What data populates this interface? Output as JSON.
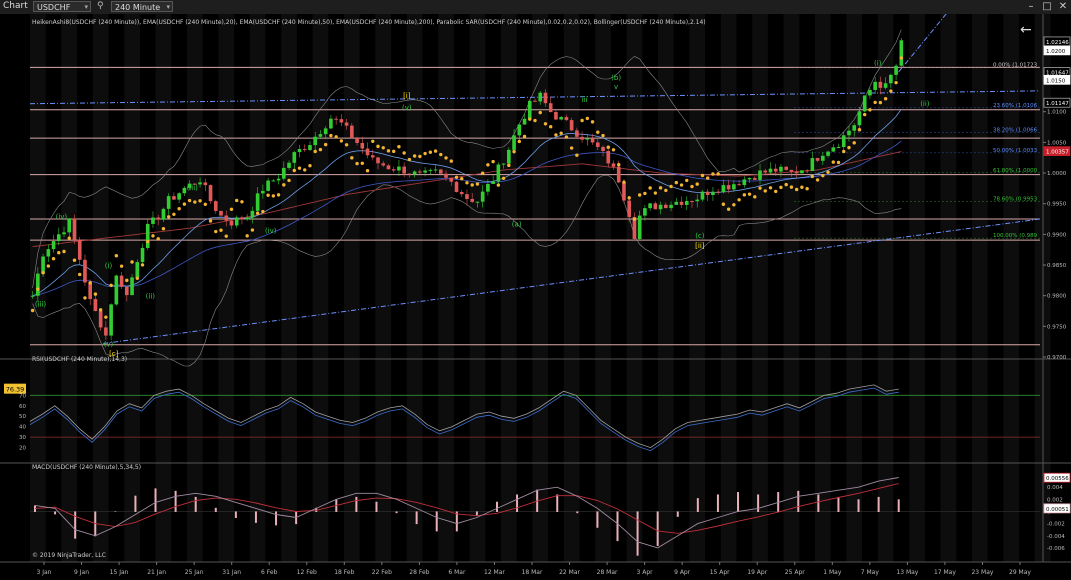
{
  "toolbar": {
    "menu_label": "Chart",
    "instrument": "USDCHF",
    "timeframe": "240 Minute",
    "search_icon": "search-icon",
    "window_icons": [
      "minimize-icon",
      "maximize-icon",
      "close-icon"
    ]
  },
  "indicators_title": "HeikenAshi8(USDCHF (240 Minute)), EMA(USDCHF (240 Minute),20), EMA(USDCHF (240 Minute),50), EMA(USDCHF (240 Minute),200), Parabolic SAR(USDCHF (240 Minute),0.02,0.2,0.02), Bollinger(USDCHF (240 Minute),2.14)",
  "rsi_title": "RSI(USDCHF (240 Minute),14,3)",
  "macd_title": "MACD(USDCHF (240 Minute),5,34,5)",
  "copyright": "© 2019 NinjaTrader, LLC",
  "back_arrow": "←",
  "colors": {
    "bull": "#32cd32",
    "bear": "#e05858",
    "sar": "#f2b431",
    "ema20": "#6b9ee8",
    "ema50": "#3f58c8",
    "ema200": "#a03838",
    "bollinger": "#8a8a8a",
    "hline": "#d9a9a9",
    "trend": "#6c8fff",
    "fib_pos": "#5d8eff",
    "fib_neg": "#34c234",
    "wave_green": "#2ecc40",
    "wave_yellow": "#ffe600"
  },
  "chart_data": [
    {
      "type": "candlestick",
      "symbol": "USDCHF",
      "timeframe": "240 Minute",
      "ylim": [
        0.97,
        1.023
      ],
      "y_ticks": [
        "1.0150",
        "1.0100",
        "1.0050",
        "1.0000",
        "0.9950",
        "0.9900",
        "0.9850",
        "0.9800",
        "0.9750",
        "0.9700"
      ],
      "y_tick_values": [
        1.015,
        1.01,
        1.005,
        1.0,
        0.995,
        0.99,
        0.985,
        0.98,
        0.975,
        0.97
      ],
      "x_ticks": [
        "3 Jan",
        "9 Jan",
        "15 Jan",
        "21 Jan",
        "25 Jan",
        "31 Jan",
        "6 Feb",
        "12 Feb",
        "18 Feb",
        "22 Feb",
        "28 Feb",
        "6 Mar",
        "12 Mar",
        "18 Mar",
        "22 Mar",
        "28 Mar",
        "3 Apr",
        "9 Apr",
        "15 Apr",
        "19 Apr",
        "25 Apr",
        "1 May",
        "7 May",
        "13 May",
        "17 May",
        "23 May",
        "29 May"
      ],
      "price_path": [
        [
          0,
          0.98
        ],
        [
          2,
          0.987
        ],
        [
          5,
          0.99
        ],
        [
          7,
          0.992
        ],
        [
          9,
          0.986
        ],
        [
          11,
          0.979
        ],
        [
          13,
          0.9755
        ],
        [
          14,
          0.9735
        ],
        [
          15,
          0.979
        ],
        [
          16,
          0.983
        ],
        [
          17,
          0.982
        ],
        [
          18,
          0.98
        ],
        [
          20,
          0.986
        ],
        [
          22,
          0.991
        ],
        [
          24,
          0.993
        ],
        [
          26,
          0.9955
        ],
        [
          29,
          0.9975
        ],
        [
          32,
          0.999
        ],
        [
          34,
          0.9955
        ],
        [
          36,
          0.993
        ],
        [
          38,
          0.992
        ],
        [
          41,
          0.993
        ],
        [
          44,
          0.9975
        ],
        [
          47,
          0.9995
        ],
        [
          50,
          1.003
        ],
        [
          53,
          1.005
        ],
        [
          55,
          1.007
        ],
        [
          57,
          1.009
        ],
        [
          59,
          1.008
        ],
        [
          61,
          1.006
        ],
        [
          63,
          1.004
        ],
        [
          65,
          1.002
        ],
        [
          68,
          1.001
        ],
        [
          71,
          1.0005
        ],
        [
          74,
          0.9995
        ],
        [
          77,
          1.0
        ],
        [
          80,
          0.9985
        ],
        [
          83,
          0.996
        ],
        [
          85,
          0.9955
        ],
        [
          88,
          0.999
        ],
        [
          91,
          1.004
        ],
        [
          93,
          1.008
        ],
        [
          95,
          1.011
        ],
        [
          97,
          1.0125
        ],
        [
          99,
          1.01
        ],
        [
          102,
          1.008
        ],
        [
          105,
          1.006
        ],
        [
          108,
          1.004
        ],
        [
          110,
          1.002
        ],
        [
          112,
          0.999
        ],
        [
          114,
          0.9935
        ],
        [
          115,
          0.99
        ],
        [
          116,
          0.993
        ],
        [
          118,
          0.9945
        ],
        [
          121,
          0.995
        ],
        [
          124,
          0.9955
        ],
        [
          127,
          0.996
        ],
        [
          130,
          0.9975
        ],
        [
          133,
          0.998
        ],
        [
          136,
          0.999
        ],
        [
          139,
          1.0
        ],
        [
          142,
          1.0005
        ],
        [
          145,
          1.0
        ],
        [
          148,
          1.001
        ],
        [
          151,
          1.0035
        ],
        [
          154,
          1.005
        ],
        [
          157,
          1.008
        ],
        [
          159,
          1.012
        ],
        [
          161,
          1.015
        ],
        [
          163,
          1.014
        ],
        [
          165,
          1.0175
        ],
        [
          166,
          1.021
        ]
      ],
      "ema200_path": [
        [
          0,
          0.988
        ],
        [
          15,
          0.9895
        ],
        [
          30,
          0.991
        ],
        [
          45,
          0.9935
        ],
        [
          60,
          0.9965
        ],
        [
          75,
          0.9985
        ],
        [
          90,
          1.0005
        ],
        [
          105,
          1.0015
        ],
        [
          120,
          1.0
        ],
        [
          135,
          0.9995
        ],
        [
          150,
          1.0005
        ],
        [
          166,
          1.0035
        ]
      ],
      "horizontal_levels": [
        1.01723,
        1.01033,
        1.0057,
        0.99975,
        0.9925,
        0.98905,
        0.972
      ],
      "trendlines": [
        {
          "name": "upper-channel",
          "from": [
            0,
            1.0113
          ],
          "to": [
            193,
            1.0134
          ]
        },
        {
          "name": "lower-channel",
          "from": [
            14,
            0.9722
          ],
          "to": [
            193,
            0.9925
          ]
        },
        {
          "name": "projection",
          "from": [
            166,
            1.0165
          ],
          "to": [
            178,
            1.029
          ]
        }
      ],
      "fib_levels": [
        {
          "label": "0.00% (1.01723",
          "value": 1.01723
        },
        {
          "label": "23.60% (1.0106",
          "value": 1.01064
        },
        {
          "label": "38.20% (1.0066",
          "value": 1.00658
        },
        {
          "label": "50.00% (1.0033",
          "value": 1.0033
        },
        {
          "label": "61.80% (1.0000",
          "value": 1.00003
        },
        {
          "label": "78.60% (0.9953",
          "value": 0.99535
        },
        {
          "label": "100.00% (0.989",
          "value": 0.98938
        }
      ],
      "price_flags": [
        {
          "text": "1.02146",
          "value": 1.02146,
          "style": "outline"
        },
        {
          "text": "1.0200",
          "value": 1.02,
          "style": "white"
        },
        {
          "text": "1.01647",
          "value": 1.01647,
          "style": "outline"
        },
        {
          "text": "1.0150",
          "value": 1.0152,
          "style": "white"
        },
        {
          "text": "1.01147",
          "value": 1.01147,
          "style": "outline"
        },
        {
          "text": "1.00357",
          "value": 1.00357,
          "style": "red"
        }
      ],
      "wave_labels": [
        {
          "text": "(iv)",
          "x": 6,
          "value": 0.9925,
          "color": "green"
        },
        {
          "text": "(iii)",
          "x": 2,
          "value": 0.9782,
          "color": "green"
        },
        {
          "text": "(i)",
          "x": 15,
          "value": 0.9845,
          "color": "green"
        },
        {
          "text": "(ii)",
          "x": 23,
          "value": 0.9795,
          "color": "green"
        },
        {
          "text": "(v)",
          "x": 15,
          "value": 0.9717,
          "color": "green"
        },
        {
          "text": "[c]",
          "x": 16,
          "value": 0.9702,
          "color": "yellow"
        },
        {
          "text": "(iii)",
          "x": 31,
          "value": 0.9972,
          "color": "green"
        },
        {
          "text": "(iv)",
          "x": 46,
          "value": 0.9902,
          "color": "green"
        },
        {
          "text": "[i]",
          "x": 72,
          "value": 1.0122,
          "color": "yellow"
        },
        {
          "text": "(v)",
          "x": 72,
          "value": 1.0103,
          "color": "green"
        },
        {
          "text": "(a)",
          "x": 93,
          "value": 0.9913,
          "color": "green"
        },
        {
          "text": "iii",
          "x": 106,
          "value": 1.0116,
          "color": "green"
        },
        {
          "text": "(b)",
          "x": 112,
          "value": 1.0152,
          "color": "green"
        },
        {
          "text": "v",
          "x": 112,
          "value": 1.0137,
          "color": "green"
        },
        {
          "text": "(c)",
          "x": 128,
          "value": 0.9894,
          "color": "green"
        },
        {
          "text": "[ii]",
          "x": 128,
          "value": 0.9878,
          "color": "yellow"
        },
        {
          "text": "(i)",
          "x": 162,
          "value": 1.0175,
          "color": "green"
        },
        {
          "text": "(ii)",
          "x": 171,
          "value": 1.0109,
          "color": "green"
        }
      ]
    },
    {
      "type": "line",
      "name": "rsi",
      "ylim": [
        10,
        100
      ],
      "y_ticks": [
        70,
        60,
        50,
        40,
        30,
        20
      ],
      "levels": [
        70,
        30
      ],
      "current_value": "76.39",
      "values": [
        45,
        52,
        60,
        50,
        38,
        28,
        40,
        55,
        62,
        58,
        70,
        74,
        76,
        70,
        62,
        55,
        48,
        44,
        50,
        56,
        60,
        68,
        62,
        54,
        50,
        46,
        44,
        48,
        54,
        58,
        60,
        52,
        42,
        36,
        40,
        46,
        52,
        54,
        50,
        48,
        52,
        58,
        66,
        74,
        70,
        58,
        46,
        38,
        30,
        24,
        20,
        28,
        38,
        44,
        46,
        48,
        50,
        52,
        56,
        54,
        58,
        62,
        58,
        64,
        70,
        72,
        76,
        78,
        80,
        74,
        76
      ]
    },
    {
      "type": "bar_line",
      "name": "macd",
      "ylim": [
        -0.0075,
        0.0065
      ],
      "y_ticks": [
        "0.004",
        "0.002",
        "0",
        "-0.002",
        "-0.004",
        "-0.006"
      ],
      "y_tick_values": [
        0.004,
        0.002,
        0.0,
        -0.002,
        -0.004,
        -0.006
      ],
      "current_value": "0.00556",
      "signal_value": "0.00051",
      "macd_values": [
        0.001,
        0.0005,
        -0.003,
        -0.004,
        -0.0025,
        -0.0005,
        0.0015,
        0.0025,
        0.003,
        0.0025,
        0.0015,
        0.0005,
        -0.0005,
        -0.001,
        0.0005,
        0.002,
        0.003,
        0.003,
        0.002,
        0.0005,
        -0.001,
        -0.002,
        -0.001,
        0.0005,
        0.002,
        0.0035,
        0.004,
        0.0025,
        0.0005,
        -0.002,
        -0.005,
        -0.006,
        -0.004,
        -0.002,
        -0.001,
        0.0,
        0.0005,
        0.0015,
        0.0025,
        0.003,
        0.0035,
        0.004,
        0.005,
        0.0056
      ],
      "signal_values": [
        0.0005,
        0.0007,
        -0.0008,
        -0.002,
        -0.0025,
        -0.0018,
        -0.0004,
        0.0008,
        0.0018,
        0.0022,
        0.002,
        0.0014,
        0.0006,
        0.0,
        0.0002,
        0.001,
        0.0018,
        0.0022,
        0.0021,
        0.0015,
        0.0006,
        -0.0004,
        -0.0007,
        -0.0003,
        0.0006,
        0.0017,
        0.0026,
        0.0026,
        0.0018,
        0.0004,
        -0.0014,
        -0.0032,
        -0.0036,
        -0.0031,
        -0.0024,
        -0.0016,
        -0.0009,
        -0.0001,
        0.0008,
        0.0016,
        0.0023,
        0.003,
        0.0038,
        0.0046
      ]
    }
  ]
}
